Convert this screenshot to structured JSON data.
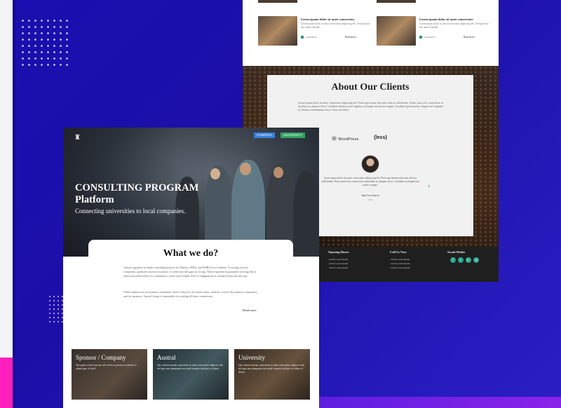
{
  "back_page": {
    "blog_cards": [
      {
        "title": "Lorem ipsum dolor sit amet consectetur",
        "text": "Lorem ipsum dolor sit amet consectetur adipiscing elit. Sed quis nisi nec mauris blandit.",
        "date": "24/09/2019",
        "read_more": "Read more"
      },
      {
        "title": "Lorem ipsum dolor sit amet consectetur",
        "text": "Lorem ipsum dolor sit amet consectetur adipiscing elit. Sed quis nisi nec mauris blandit.",
        "date": "24/09/2019",
        "read_more": "Read more"
      }
    ],
    "clients": {
      "title": "About Our Clients",
      "text": "Lorem ipsum dolor sit amet, consectetur adipiscing elit. Proin eget massa vitae ante ultrices sollicitudin. Donec justo nisi, consectetur ut faucibus in, aliquam id est. Curabitur facilisis tortor dapibus, at feugiat sem auctor congue. Curabitur ipsum metus, feugiat sed vulputate in, dictum condimentum tortor. Nunc non dolor.",
      "logos": [
        "jQuery",
        "WordPress",
        "{less}"
      ],
      "testimonial": "Lorem ipsum dolor sit amet, consectetur adipiscing elit. Proin eget massa vitae ante ultrices sollicitudin. Donec justo nisi, consectetur ut faucibus in, aliquam id est. Curabitur ut feugiat sem auctor congue.",
      "name": "Juan Cruz Garcia",
      "role": "CEO"
    },
    "footer": {
      "col1": {
        "head": "Opening Hours",
        "links": [
          "Item Lorem Ipsum",
          "Item Lorem Ipsum",
          "Item Lorem Ipsum"
        ]
      },
      "col2": {
        "head": "Call Us Now",
        "links": [
          "Item Lorem Ipsum",
          "Item Lorem Ipsum",
          "Item Lorem Ipsum"
        ]
      },
      "col3": {
        "head": "Social Media",
        "icons": [
          "f",
          "t",
          "in",
          "ig"
        ]
      }
    }
  },
  "front_page": {
    "badges": {
      "company": "COMPANY",
      "university": "UNIVERSITY"
    },
    "hero_title": "CONSULTING PROGRAM Platform",
    "hero_subtitle": "Connecting universities to local companies.",
    "what_we_do": {
      "title": "What we do?",
      "p1": "Austral organizes in-depth consulting projects for Masters, MBA, and EMBA level students. Focusing on local companies, graduates increase economic or otherwise full gaps by facing. These experiences guarantee exciting that is often associated solely in a consultancy career and a higher level of engagement in standard study abroad trips.",
      "p2": "When students are on business consultants, there's value for the whole chain: students, school, the business community, and for sponsors. Austral Group is responsible for making all these connections.",
      "read_more": "Read more"
    },
    "cards": [
      {
        "title": "Sponsor / Company",
        "text": "Nor again is there anyone who loves or pursues or desires to obtain pain of itself."
      },
      {
        "title": "Austral",
        "text": "Qui consecte ipsum, quia dolor sit amet consectetur adipisci velit, sed quia non numquam eius modi tempora incidunt, ut labore."
      },
      {
        "title": "University",
        "text": "Qui consecte ipsum, quia dolor sit amet consectetur adipisci velit, sed quia non numquam eius modi tempora incidunt, ut labore et dolore."
      }
    ]
  },
  "colors": {
    "background": "#1c0fa8",
    "accent_green": "#2a9a6c",
    "badge_company": "#3b7fd6",
    "badge_university": "#33a360",
    "pink": "#ff1fbf"
  }
}
